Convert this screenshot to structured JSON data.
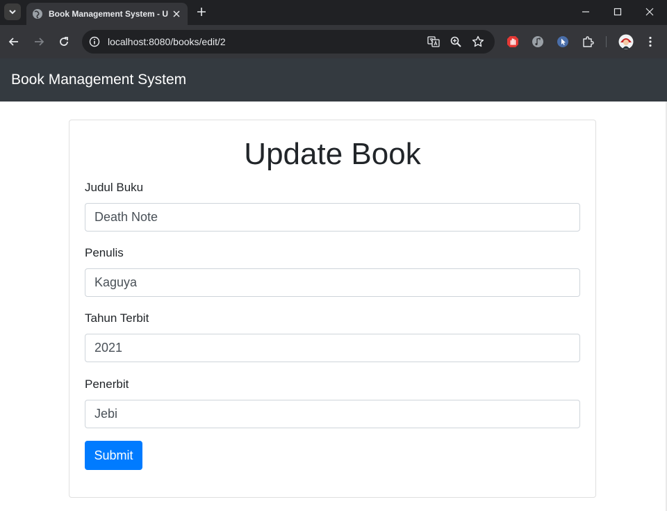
{
  "browser": {
    "tab_title": "Book Management System - U",
    "url": "localhost:8080/books/edit/2"
  },
  "navbar": {
    "brand": "Book Management System"
  },
  "form": {
    "title": "Update Book",
    "fields": [
      {
        "label": "Judul Buku",
        "value": "Death Note"
      },
      {
        "label": "Penulis",
        "value": "Kaguya"
      },
      {
        "label": "Tahun Terbit",
        "value": "2021"
      },
      {
        "label": "Penerbit",
        "value": "Jebi"
      }
    ],
    "submit_label": "Submit"
  },
  "icons": {
    "tab_search": "chevron-down-icon",
    "favicon": "globe-icon",
    "tab_close": "close-icon",
    "new_tab": "plus-icon",
    "back": "arrow-left-icon",
    "forward": "arrow-right-icon",
    "reload": "reload-icon",
    "site_info": "info-icon",
    "translate": "translate-icon",
    "zoom": "zoom-icon",
    "bookmark": "star-icon",
    "extensions": [
      "stop-hand-icon",
      "music-icon",
      "cursor-icon",
      "puzzle-icon"
    ],
    "profile": "avatar",
    "menu": "kebab-menu-icon"
  },
  "colors": {
    "navbar_bg": "#343a40",
    "primary_button": "#007bff",
    "chrome_dark": "#202124",
    "chrome_toolbar": "#35363a"
  }
}
